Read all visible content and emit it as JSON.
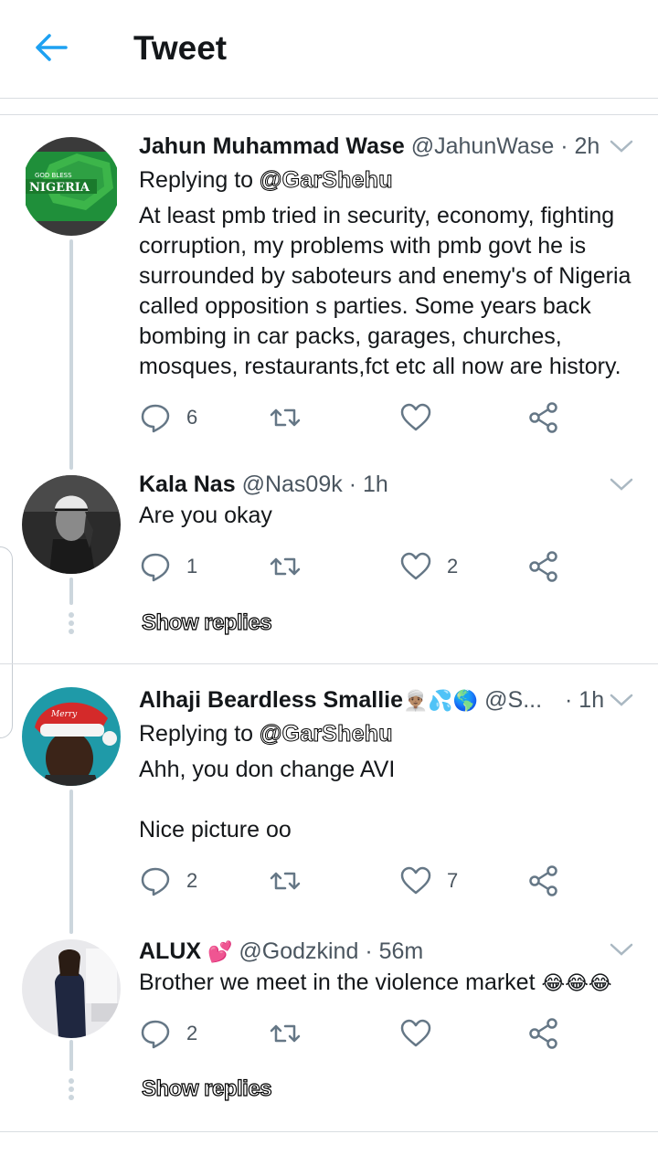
{
  "header": {
    "title": "Tweet",
    "back_icon": "back-arrow-icon",
    "accent": "#1da1f2"
  },
  "tweets": [
    {
      "name": "Jahun Muhammad Wase",
      "handle": "@JahunWase",
      "time": "· 2h",
      "replying_label": "Replying to",
      "replying_to": "@GarShehu",
      "text": "At least pmb tried in security, economy, fighting corruption, my problems with pmb govt he is surrounded by saboteurs and enemy's of Nigeria called opposition s parties. Some years back bombing in car packs, garages, churches, mosques, restaurants,fct etc all now are history.",
      "reply_count": "6",
      "retweet_count": "",
      "like_count": ""
    },
    {
      "name": "Kala Nas",
      "handle": "@Nas09k",
      "time": "· 1h",
      "text": "Are you okay",
      "reply_count": "1",
      "retweet_count": "",
      "like_count": "2",
      "show_replies": "Show replies"
    },
    {
      "name": "Alhaji Beardless Smallie",
      "name_emoji": "👳🏽‍♂️💦🌎",
      "handle": "@S...",
      "time": "· 1h",
      "replying_label": "Replying to",
      "replying_to": "@GarShehu",
      "text": "Ahh, you don change AVI\n\nNice picture oo",
      "reply_count": "2",
      "retweet_count": "",
      "like_count": "7"
    },
    {
      "name": "ALUX",
      "name_emoji": "💕",
      "handle": "@Godzkind",
      "time": "· 56m",
      "text": "Brother we meet in the violence market",
      "text_emoji": "😂😂😂",
      "reply_count": "2",
      "retweet_count": "",
      "like_count": "",
      "show_replies": "Show replies"
    }
  ]
}
